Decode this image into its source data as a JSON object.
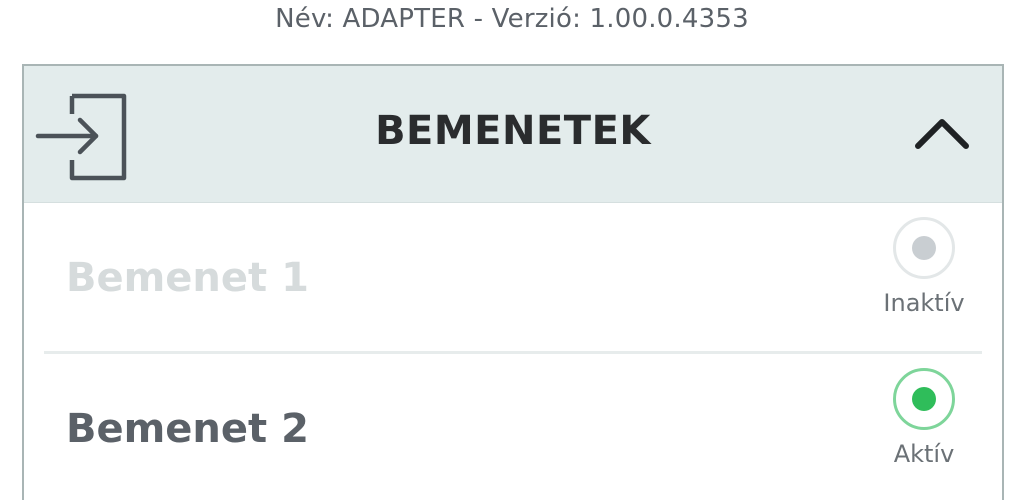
{
  "header": {
    "version_line": "Név: ADAPTER - Verzió: 1.00.0.4353"
  },
  "panel": {
    "title": "BEMENETEK",
    "icon": "login-icon",
    "collapse_icon": "chevron-up-icon"
  },
  "inputs": [
    {
      "label": "Bemenet 1",
      "status": "Inaktív",
      "active": false,
      "ring_color": "#e3e7e8",
      "dot_color": "#c9ced2"
    },
    {
      "label": "Bemenet 2",
      "status": "Aktív",
      "active": true,
      "ring_color": "#7ed59a",
      "dot_color": "#2fbd5a"
    }
  ]
}
